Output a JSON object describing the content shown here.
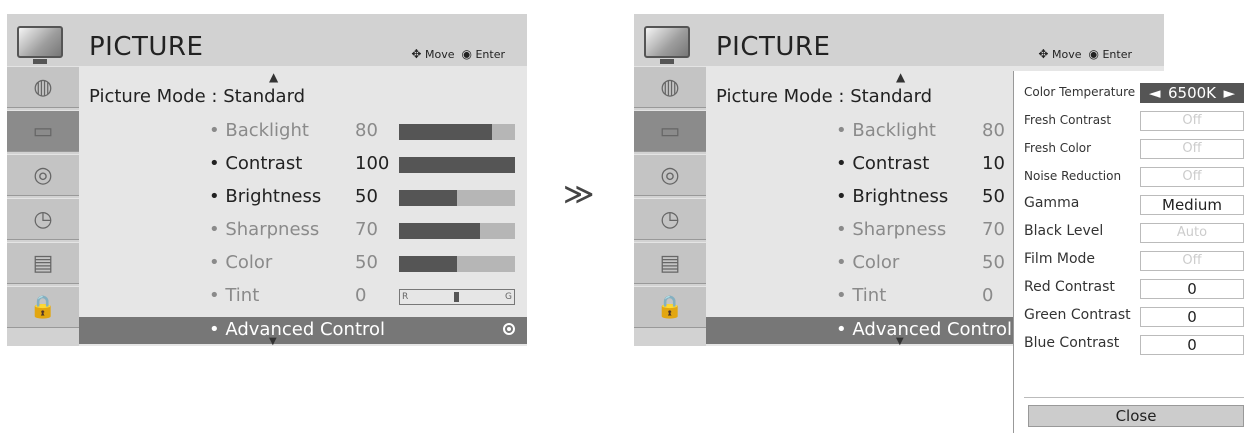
{
  "left": {
    "title": "PICTURE",
    "hint_move": "Move",
    "hint_enter": "Enter",
    "mode_label": "Picture Mode",
    "mode_value": ": Standard",
    "rows": [
      {
        "label": "• Backlight",
        "value": "80",
        "level": 0.8,
        "dim": true
      },
      {
        "label": "• Contrast",
        "value": "100",
        "level": 1.0,
        "dim": false
      },
      {
        "label": "• Brightness",
        "value": "50",
        "level": 0.5,
        "dim": false
      },
      {
        "label": "• Sharpness",
        "value": "70",
        "level": 0.7,
        "dim": true
      },
      {
        "label": "• Color",
        "value": "50",
        "level": 0.5,
        "dim": true
      },
      {
        "label": "• Tint",
        "value": "0",
        "level": null,
        "dim": true
      }
    ],
    "tint_left": "R",
    "tint_right": "G",
    "advanced": "• Advanced Control"
  },
  "right": {
    "title": "PICTURE",
    "hint_move": "Move",
    "hint_enter": "Enter",
    "mode_label": "Picture Mode",
    "mode_value": ": Standard",
    "rows": [
      {
        "label": "• Backlight",
        "value": "80",
        "dim": true
      },
      {
        "label": "• Contrast",
        "value": "10",
        "dim": false
      },
      {
        "label": "• Brightness",
        "value": "50",
        "dim": false
      },
      {
        "label": "• Sharpness",
        "value": "70",
        "dim": true
      },
      {
        "label": "• Color",
        "value": "50",
        "dim": true
      },
      {
        "label": "• Tint",
        "value": "0",
        "dim": true
      }
    ],
    "advanced": "• Advanced Control"
  },
  "overlay": {
    "items": [
      {
        "label": "Color Temperature",
        "value": "6500K"
      },
      {
        "label": "Fresh Contrast",
        "value": "Off"
      },
      {
        "label": "Fresh Color",
        "value": "Off"
      },
      {
        "label": "Noise Reduction",
        "value": "Off"
      },
      {
        "label": "Gamma",
        "value": "Medium"
      },
      {
        "label": "Black Level",
        "value": "Auto"
      },
      {
        "label": "Film Mode",
        "value": "Off"
      },
      {
        "label": "Red Contrast",
        "value": "0"
      },
      {
        "label": "Green Contrast",
        "value": "0"
      },
      {
        "label": "Blue Contrast",
        "value": "0"
      }
    ],
    "close": "Close"
  },
  "colors": {
    "panel": "#d2d2d2",
    "main": "#e6e6e6",
    "selected": "#777777",
    "bar_fill": "#555555"
  },
  "icons": [
    "tv-icon",
    "globe-icon",
    "picture-icon",
    "speaker-icon",
    "clock-icon",
    "option-icon",
    "lock-icon"
  ]
}
